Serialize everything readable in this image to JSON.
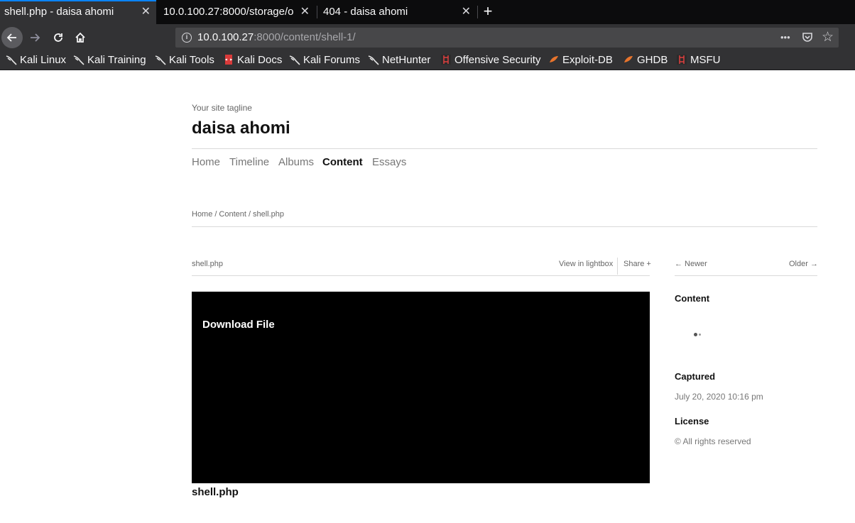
{
  "browser": {
    "tabs": [
      {
        "title": "shell.php - daisa ahomi",
        "active": true
      },
      {
        "title": "10.0.100.27:8000/storage/o",
        "active": false
      },
      {
        "title": "404 - daisa ahomi",
        "active": false
      }
    ],
    "new_tab_label": "+",
    "close_glyph": "✕",
    "url": {
      "host": "10.0.100.27",
      "rest": ":8000/content/shell-1/"
    },
    "url_actions": {
      "more": "•••",
      "pocket": "pocket-icon",
      "star": "☆"
    },
    "bookmarks": [
      {
        "label": "Kali Linux",
        "icon": "kali-dragon-icon"
      },
      {
        "label": "Kali Training",
        "icon": "kali-dragon-icon"
      },
      {
        "label": "Kali Tools",
        "icon": "kali-dragon-icon"
      },
      {
        "label": "Kali Docs",
        "icon": "kali-docs-icon"
      },
      {
        "label": "Kali Forums",
        "icon": "kali-dragon-icon"
      },
      {
        "label": "NetHunter",
        "icon": "kali-dragon-icon"
      },
      {
        "label": "Offensive Security",
        "icon": "offsec-icon"
      },
      {
        "label": "Exploit-DB",
        "icon": "exploitdb-icon"
      },
      {
        "label": "GHDB",
        "icon": "exploitdb-icon"
      },
      {
        "label": "MSFU",
        "icon": "offsec-icon"
      }
    ]
  },
  "site": {
    "tagline": "Your site tagline",
    "title": "daisa ahomi",
    "nav": [
      {
        "label": "Home",
        "current": false
      },
      {
        "label": "Timeline",
        "current": false
      },
      {
        "label": "Albums",
        "current": false
      },
      {
        "label": "Content",
        "current": true
      },
      {
        "label": "Essays",
        "current": false
      }
    ],
    "breadcrumb": [
      "Home",
      "/",
      "Content",
      "/",
      "shell.php"
    ]
  },
  "item": {
    "name": "shell.php",
    "view_lightbox": "View in lightbox",
    "share": "Share +",
    "download": "Download File",
    "caption": "shell.php"
  },
  "sidebar": {
    "newer": "← Newer",
    "older": "Older →",
    "content_heading": "Content",
    "captured_heading": "Captured",
    "captured_value": "July 20, 2020 10:16 pm",
    "license_heading": "License",
    "license_value": "© All rights reserved"
  },
  "colors": {
    "tab_accent": "#0a84ff",
    "chrome_dark": "#0c0c0d",
    "chrome_mid": "#323234",
    "media_bg": "#000000"
  }
}
